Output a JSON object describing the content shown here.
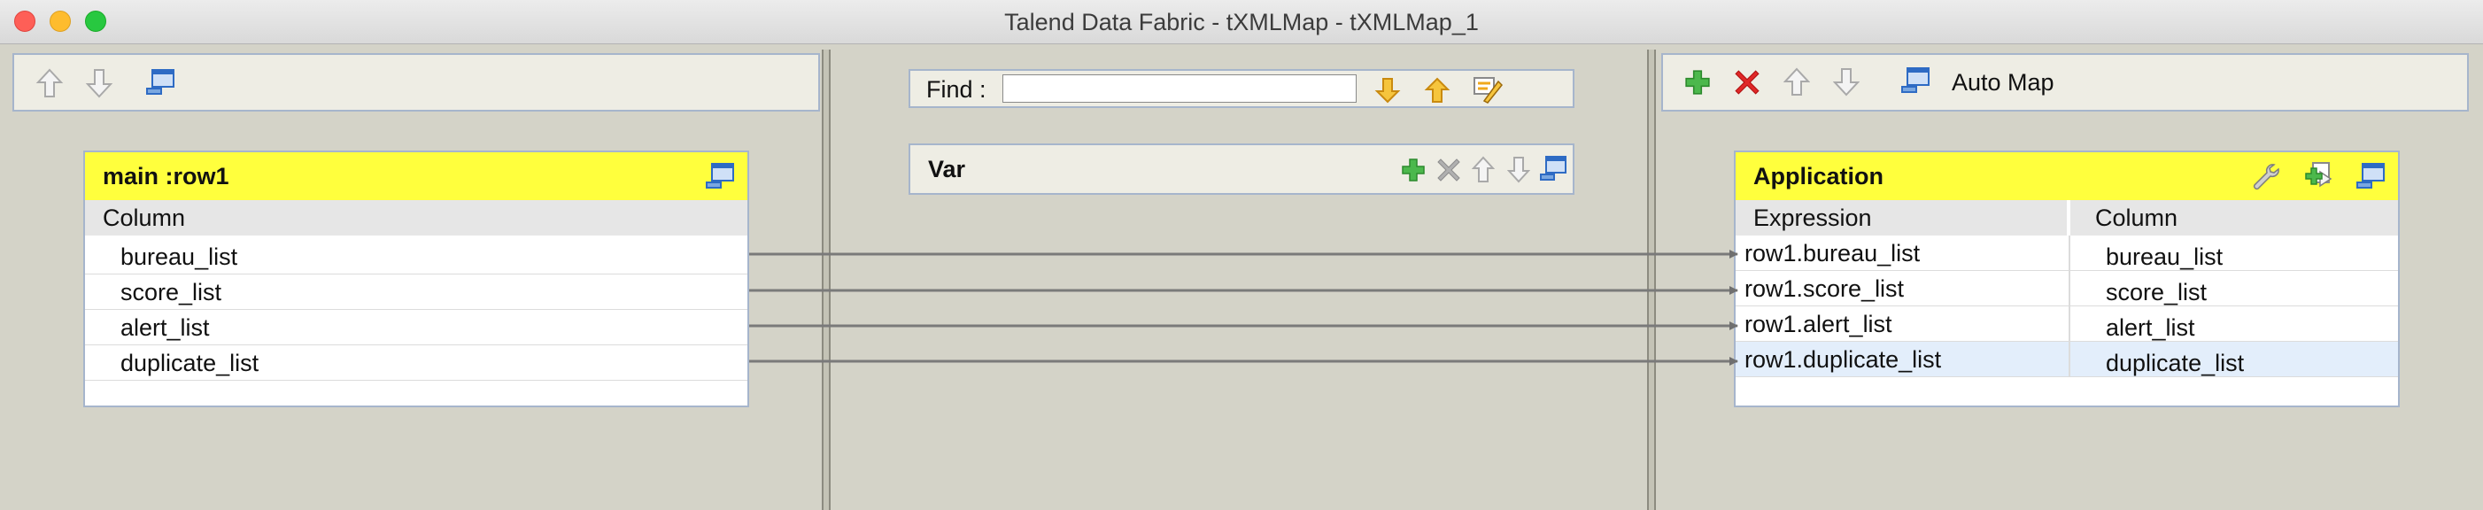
{
  "window": {
    "title": "Talend Data Fabric - tXMLMap - tXMLMap_1"
  },
  "icons": {
    "move_up": "arrow-up-icon",
    "move_down": "arrow-down-icon",
    "minimize": "minimize-window-icon",
    "add": "plus-icon",
    "remove": "x-icon",
    "find_next": "find-down-icon",
    "find_prev": "find-up-icon",
    "highlight": "highlight-icon",
    "wrench": "wrench-icon",
    "import": "import-icon"
  },
  "colors": {
    "table_header": "#ffff3d",
    "add": "#3fa33f",
    "remove": "#d81f1f",
    "find_arrows": "#f0a81c",
    "link": "#7a7a7a"
  },
  "find": {
    "label": "Find :",
    "value": ""
  },
  "var": {
    "title": "Var"
  },
  "output_toolbar": {
    "auto_map_label": "Auto Map"
  },
  "input_table": {
    "title": "main :row1",
    "column_header": "Column",
    "rows": [
      "bureau_list",
      "score_list",
      "alert_list",
      "duplicate_list"
    ]
  },
  "output_table": {
    "title": "Application",
    "expression_header": "Expression",
    "column_header": "Column",
    "rows": [
      {
        "expression": "row1.bureau_list",
        "column": "bureau_list"
      },
      {
        "expression": "row1.score_list",
        "column": "score_list"
      },
      {
        "expression": "row1.alert_list",
        "column": "alert_list"
      },
      {
        "expression": "row1.duplicate_list",
        "column": "duplicate_list"
      }
    ]
  }
}
